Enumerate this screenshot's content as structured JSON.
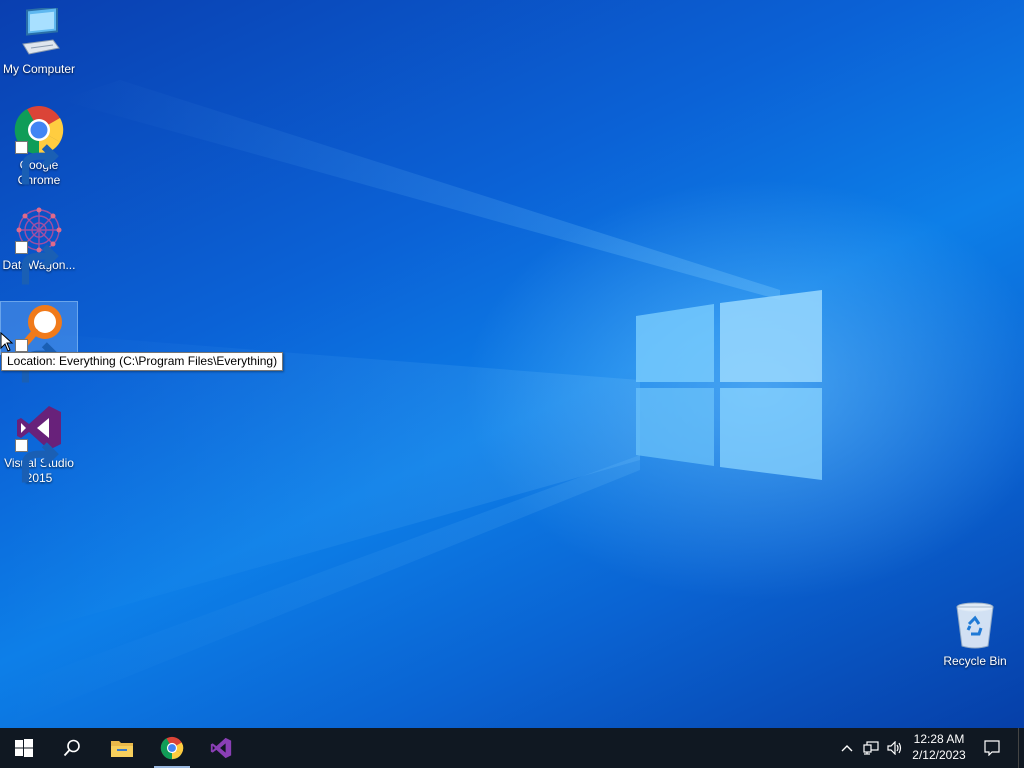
{
  "desktop": {
    "icons": [
      {
        "label": "My Computer"
      },
      {
        "label": "Google Chrome"
      },
      {
        "label": "DataWagon..."
      },
      {
        "label": ""
      },
      {
        "label": "Visual Studio 2015"
      },
      {
        "label": "Recycle Bin"
      }
    ],
    "tooltip": "Location: Everything (C:\\Program Files\\Everything)"
  },
  "taskbar": {
    "pinned": [
      "start-icon",
      "search-icon",
      "file-explorer-icon",
      "chrome-icon",
      "visual-studio-icon"
    ],
    "tray_icons": [
      "chevron-up-icon",
      "network-icon",
      "volume-icon"
    ],
    "clock": {
      "time": "12:28 AM",
      "date": "2/12/2023"
    }
  },
  "colors": {
    "taskbar": "#101822",
    "desktop_blue": "#0b62d6"
  }
}
